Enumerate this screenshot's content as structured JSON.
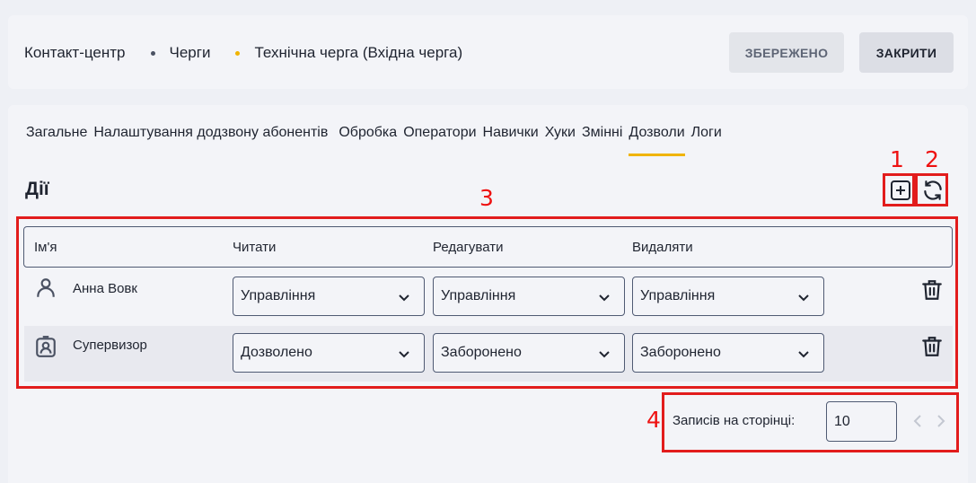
{
  "breadcrumb": {
    "items": [
      "Контакт-центр",
      "Черги",
      "Технічна черга (Вхідна черга)"
    ]
  },
  "buttons": {
    "saved": "ЗБЕРЕЖЕНО",
    "close": "ЗАКРИТИ"
  },
  "tabs": [
    {
      "label": "Загальне"
    },
    {
      "label": "Налаштування додзвону абонентів"
    },
    {
      "label": "Обробка"
    },
    {
      "label": "Оператори"
    },
    {
      "label": "Навички"
    },
    {
      "label": "Хуки"
    },
    {
      "label": "Змінні"
    },
    {
      "label": "Дозволи",
      "active": true
    },
    {
      "label": "Логи"
    }
  ],
  "section": {
    "title": "Дії"
  },
  "table": {
    "columns": [
      "Ім'я",
      "Читати",
      "Редагувати",
      "Видаляти"
    ],
    "rows": [
      {
        "name": "Анна Вовк",
        "icon": "user-icon",
        "read": "Управління",
        "edit": "Управління",
        "delete": "Управління"
      },
      {
        "name": "Супервизор",
        "icon": "badge-icon",
        "read": "Дозволено",
        "edit": "Заборонено",
        "delete": "Заборонено"
      }
    ]
  },
  "pagination": {
    "label": "Записів на сторінці:",
    "per_page": "10"
  },
  "annotations": [
    "1",
    "2",
    "3",
    "4"
  ],
  "colors": {
    "accent": "#f0b400",
    "annotation": "#e21c1c",
    "border": "#4f5a73"
  }
}
